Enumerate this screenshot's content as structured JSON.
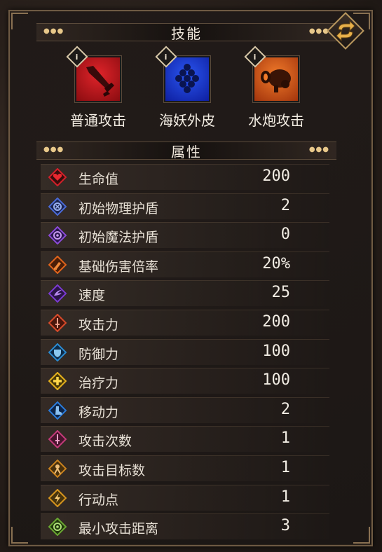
{
  "skills_section": {
    "title": "技能"
  },
  "skills": [
    {
      "label": "普通攻击",
      "icon": "sword-strike-icon",
      "color": "#c4161c"
    },
    {
      "label": "海妖外皮",
      "icon": "scales-icon",
      "color": "#1a3bd6"
    },
    {
      "label": "水炮攻击",
      "icon": "water-cannon-icon",
      "color": "#d9541a"
    }
  ],
  "attributes_section": {
    "title": "属性"
  },
  "attributes": [
    {
      "name": "生命值",
      "value": "200",
      "icon": "heart-icon",
      "color": "#d4202a"
    },
    {
      "name": "初始物理护盾",
      "value": "2",
      "icon": "physical-shield-icon",
      "color": "#4a6ad6"
    },
    {
      "name": "初始魔法护盾",
      "value": "0",
      "icon": "magic-shield-icon",
      "color": "#8a4ad6"
    },
    {
      "name": "基础伤害倍率",
      "value": "20%",
      "icon": "damage-multiplier-icon",
      "color": "#e0641c"
    },
    {
      "name": "速度",
      "value": "25",
      "icon": "speed-icon",
      "color": "#7a3ad0"
    },
    {
      "name": "攻击力",
      "value": "200",
      "icon": "attack-icon",
      "color": "#d84a2a"
    },
    {
      "name": "防御力",
      "value": "100",
      "icon": "defense-icon",
      "color": "#2a8ad0"
    },
    {
      "name": "治疗力",
      "value": "100",
      "icon": "heal-icon",
      "color": "#e6b21c"
    },
    {
      "name": "移动力",
      "value": "2",
      "icon": "boot-icon",
      "color": "#2a7ad8"
    },
    {
      "name": "攻击次数",
      "value": "1",
      "icon": "attack-count-icon",
      "color": "#c43a7a"
    },
    {
      "name": "攻击目标数",
      "value": "1",
      "icon": "target-count-icon",
      "color": "#c9821e"
    },
    {
      "name": "行动点",
      "value": "1",
      "icon": "action-point-icon",
      "color": "#d8961e"
    },
    {
      "name": "最小攻击距离",
      "value": "3",
      "icon": "min-range-icon",
      "color": "#6aa832"
    }
  ],
  "accent": "#e8c88a"
}
